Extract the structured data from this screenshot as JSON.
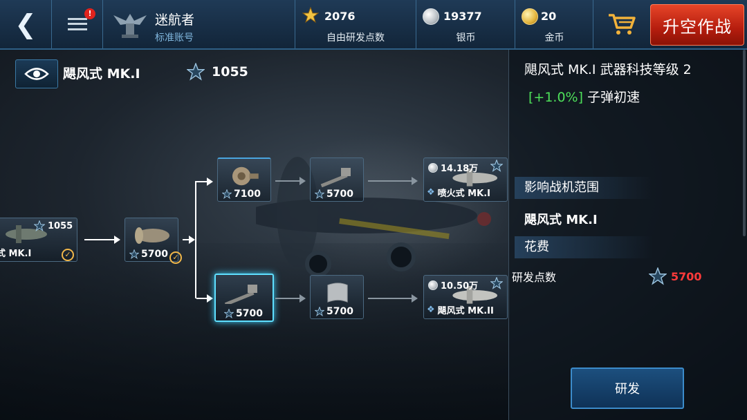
{
  "topbar": {
    "back_icon": "chevron-left-icon",
    "menu_icon": "hamburger-menu-icon",
    "notification_badge": "!",
    "profile": {
      "name": "迷航者",
      "account_type": "标准账号",
      "emblem_icon": "eagle-emblem-icon"
    },
    "resources": [
      {
        "value": "2076",
        "label": "自由研发点数",
        "icon": "gold-star-icon"
      },
      {
        "value": "19377",
        "label": "银币",
        "icon": "silver-coin-icon"
      },
      {
        "value": "20",
        "label": "金币",
        "icon": "gold-coin-icon"
      }
    ],
    "cart_icon": "shopping-cart-icon",
    "launch_label": "升空作战"
  },
  "subheader": {
    "eye_icon": "eye-icon",
    "plane_name": "飓风式 MK.I",
    "research_points": "1055"
  },
  "tree": {
    "root": {
      "name": "式 MK.I",
      "points": "1055",
      "completed": true
    },
    "node_engine": {
      "cost": "5700",
      "completed": true
    },
    "node_turbine": {
      "cost": "7100"
    },
    "node_gun_top": {
      "cost": "5700"
    },
    "node_gun_selected": {
      "cost": "5700"
    },
    "node_armor": {
      "cost": "5700"
    },
    "next_plane_top": {
      "price": "14.18万",
      "name": "喷火式 MK.I"
    },
    "next_plane_bottom": {
      "price": "10.50万",
      "name": "飓风式 MK.II"
    }
  },
  "panel": {
    "title": "飓风式 MK.I 武器科技等级 2",
    "effect_pct": "[+1.0%]",
    "effect_text": "子弹初速",
    "affected_section": "影响战机范围",
    "affected_plane": "飓风式 MK.I",
    "cost_section": "花费",
    "cost_label": "研发点数",
    "cost_value": "5700",
    "research_button": "研发"
  },
  "colors": {
    "accent_blue": "#3c8ccb",
    "launch_red": "#c62a12",
    "effect_green": "#4ee05a",
    "cost_red": "#ff3a3a"
  }
}
